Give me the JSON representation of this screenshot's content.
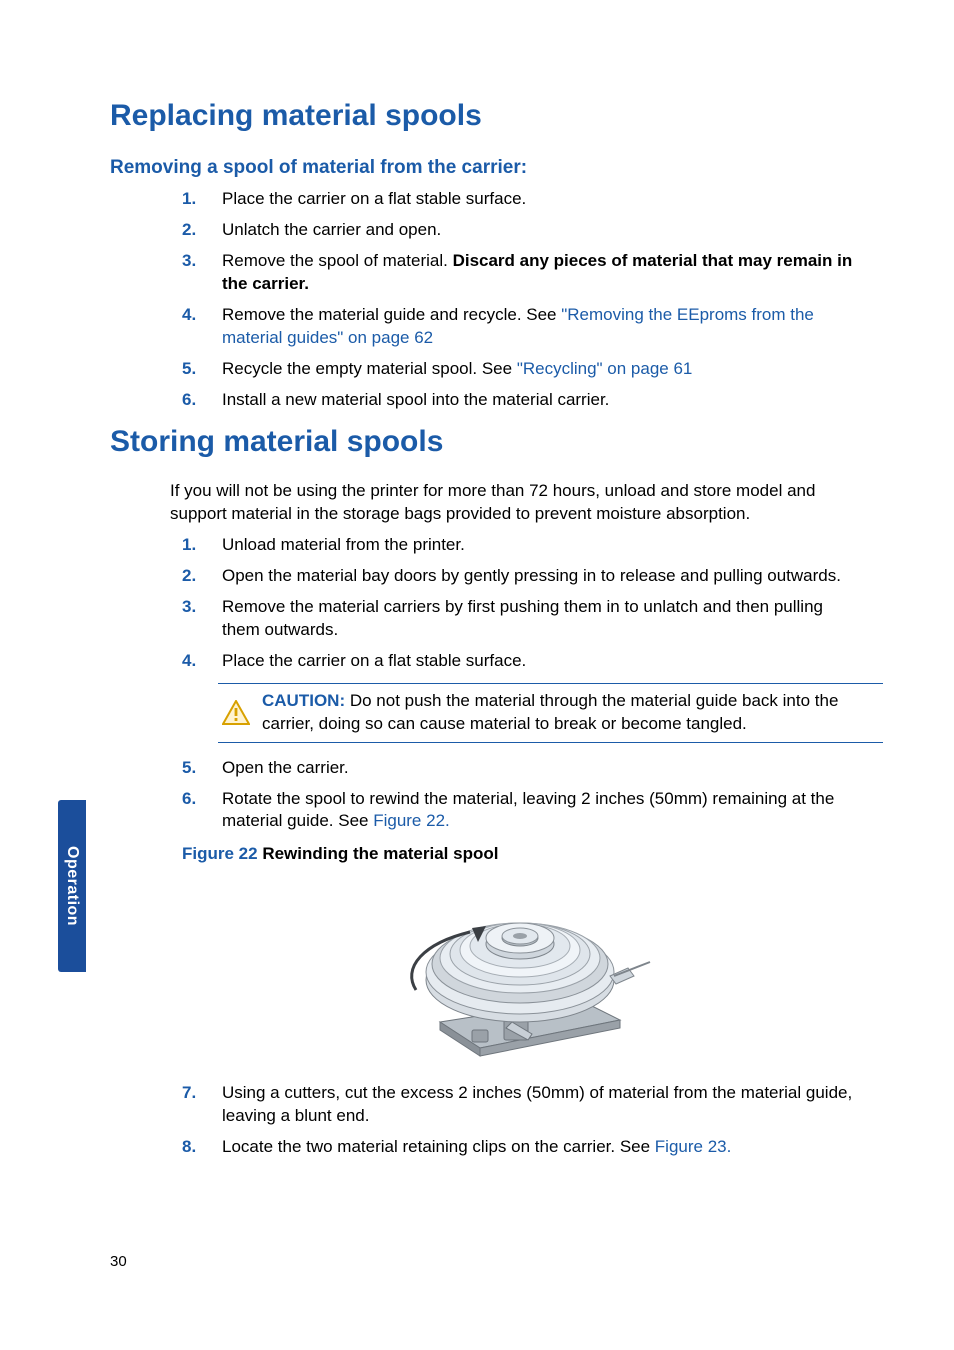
{
  "section_tab": "Operation",
  "page_number": "30",
  "h1_replacing": "Replacing material spools",
  "h2_removing": "Removing a spool of material from the carrier:",
  "remove_steps": [
    {
      "n": "1.",
      "text": "Place the carrier on a flat stable surface."
    },
    {
      "n": "2.",
      "text": "Unlatch the carrier and open."
    },
    {
      "n": "3.",
      "text_pre": "Remove the spool of material. ",
      "text_bold": "Discard any pieces of material that may remain in the carrier."
    },
    {
      "n": "4.",
      "text_pre": "Remove the material guide and recycle. See ",
      "link": "\"Removing the EEproms from the material guides\" on page 62"
    },
    {
      "n": "5.",
      "text_pre": "Recycle the empty material spool. See ",
      "link": "\"Recycling\" on page 61"
    },
    {
      "n": "6.",
      "text": "Install a new material spool into the material carrier."
    }
  ],
  "h1_storing": "Storing material spools",
  "storing_intro": "If you will not be using the printer for more than 72 hours, unload and store model and support material in the storage bags provided to prevent moisture absorption.",
  "storing_steps_a": [
    {
      "n": "1.",
      "text": "Unload material from the printer."
    },
    {
      "n": "2.",
      "text": "Open the material bay doors by gently pressing in to release and pulling outwards."
    },
    {
      "n": "3.",
      "text": "Remove the material carriers by first pushing them in to unlatch and then pulling them outwards."
    },
    {
      "n": "4.",
      "text": "Place the carrier on a flat stable surface."
    }
  ],
  "caution_label": "CAUTION:",
  "caution_text": " Do not push the material through the material guide back into the carrier, doing so can cause material to break or become tangled.",
  "storing_steps_b": [
    {
      "n": "5.",
      "text": "Open the carrier."
    },
    {
      "n": "6.",
      "text_pre": "Rotate the spool to rewind the material, leaving 2 inches (50mm) remaining at the material guide. See ",
      "link": "Figure 22."
    }
  ],
  "figure22_label": "Figure 22",
  "figure22_title": " Rewinding the material spool",
  "storing_steps_c": [
    {
      "n": "7.",
      "text": "Using a cutters, cut the excess 2 inches (50mm) of material from the material guide, leaving a blunt end."
    },
    {
      "n": "8.",
      "text_pre": "Locate the two material retaining clips on the carrier. See ",
      "link": "Figure 23."
    }
  ]
}
